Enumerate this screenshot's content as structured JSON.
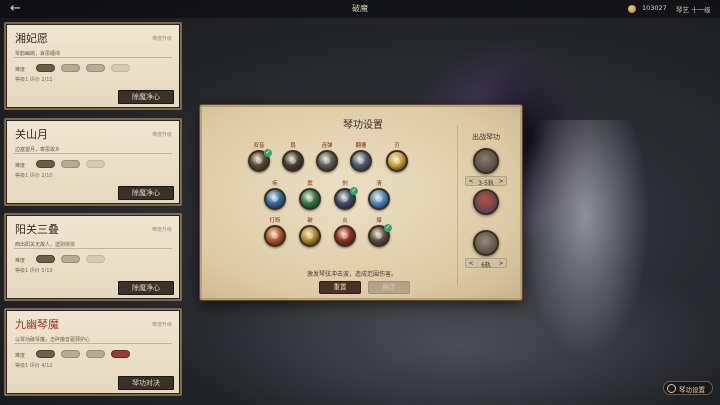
{
  "topbar": {
    "back_icon": "←",
    "title": "破魔",
    "coin_count": "103027",
    "extra": "琴艺 十一级"
  },
  "cards": [
    {
      "title": "湘妃愿",
      "tag": "难度升级",
      "desc": "琴韵幽婉，哀思缠绵",
      "diff_label": "难度",
      "meta": "等级1  评价 2/11",
      "button": "除魔净心",
      "title_color": "normal"
    },
    {
      "title": "关山月",
      "tag": "难度升级",
      "desc": "边塞望月，寄思故乡",
      "diff_label": "难度",
      "meta": "等级1  评价 2/10",
      "button": "除魔净心",
      "title_color": "normal"
    },
    {
      "title": "阳关三叠",
      "tag": "难度升级",
      "desc": "西出阳关无故人，送别依依",
      "diff_label": "难度",
      "meta": "等级1  评价 5/10",
      "button": "除魔净心",
      "title_color": "normal"
    },
    {
      "title": "九幽琴魔",
      "tag": "难度升级",
      "desc": "以琴功破琴魔，击碎魔音驱邪护心",
      "diff_label": "难度",
      "meta": "等级1  评价 4/12",
      "button": "琴功对决",
      "title_color": "red"
    }
  ],
  "dialog": {
    "title": "琴功设置",
    "hint": "激发琴弦冲击波，造成范围伤害。",
    "reset": "重置",
    "confirm": "确定",
    "side_title": "出战琴功",
    "pager_top": {
      "left": "<",
      "value": "3-5轨",
      "right": ">"
    },
    "pager_bottom": {
      "left": "<",
      "value": "6轨",
      "right": ">"
    },
    "skills": [
      {
        "label": "双音",
        "color": "#5a4a3a",
        "checked": true
      },
      {
        "label": "扇",
        "color": "#4a4036",
        "checked": false
      },
      {
        "label": "连弹",
        "color": "#5e5e5e",
        "checked": false
      },
      {
        "label": "翻覆",
        "color": "#4d5d73",
        "checked": false
      },
      {
        "label": "刃",
        "color": "#c9a032",
        "checked": false
      },
      {
        "label": "疾",
        "color": "#2f6ea8",
        "checked": false
      },
      {
        "label": "震",
        "color": "#2e7a4c",
        "checked": false
      },
      {
        "label": "刹",
        "color": "#3a4f76",
        "checked": true
      },
      {
        "label": "清",
        "color": "#4a8ac4",
        "checked": false
      },
      {
        "label": "打断",
        "color": "#b05a1e",
        "checked": false
      },
      {
        "label": "破",
        "color": "#b08a2a",
        "checked": false
      },
      {
        "label": "炎",
        "color": "#9a2e24",
        "checked": false
      },
      {
        "label": "爆",
        "color": "#5c5248",
        "checked": true
      }
    ]
  },
  "bottom_button": {
    "label": "琴功设置",
    "icon": "gear-icon"
  }
}
